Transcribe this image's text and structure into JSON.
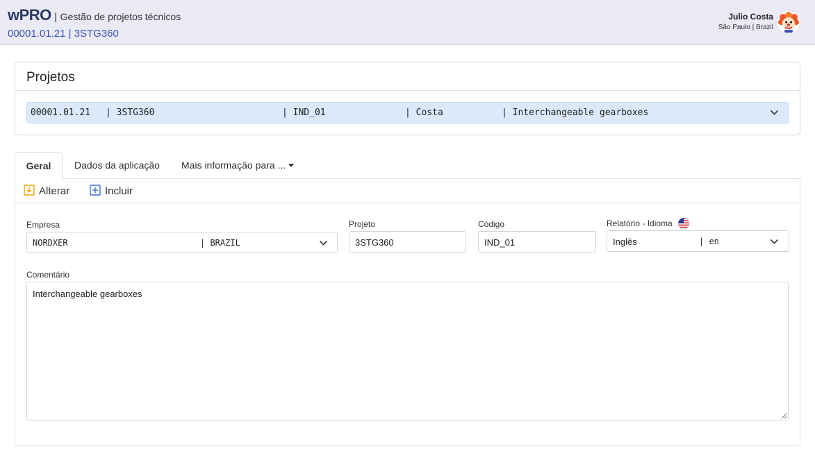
{
  "header": {
    "brand": "wPRO",
    "separator": "|",
    "subtitle": "Gestão de projetos técnicos",
    "project_id": "00001.01.21 | 3STG360",
    "user_name": "Julio Costa",
    "user_location": "São Paulo | Brazil"
  },
  "projetos": {
    "title": "Projetos",
    "selected": {
      "code": "00001.01.21",
      "name": "| 3STG360",
      "ind": "| IND_01",
      "owner": "| Costa",
      "description": "| Interchangeable gearboxes"
    }
  },
  "tabs": [
    {
      "label": "Geral"
    },
    {
      "label": "Dados da aplicação"
    },
    {
      "label": "Mais informação para ..."
    }
  ],
  "toolbar": {
    "alterar": "Alterar",
    "incluir": "Incluir"
  },
  "form": {
    "empresa_label": "Empresa",
    "empresa_name": "NORDXER",
    "empresa_country": "| BRAZIL",
    "projeto_label": "Projeto",
    "projeto_value": "3STG360",
    "codigo_label": "Código",
    "codigo_value": "IND_01",
    "idioma_label": "Relatório - Idioma",
    "idioma_name": "Inglês",
    "idioma_code": "| en",
    "comentario_label": "Comentário",
    "comentario_value": "Interchangeable gearboxes"
  },
  "colors": {
    "topbar": "#e9eaf4",
    "brand": "#2b3a63",
    "accent": "#3f51b5",
    "selected_row": "#dbe9fb",
    "alterar_icon": "#f0a500",
    "incluir_icon": "#3f6fd8"
  },
  "icons": [
    "avatar-clown",
    "chevron-down-icon",
    "arrow-down-box-icon",
    "plus-box-icon",
    "us-flag-icon",
    "resize-grip-icon"
  ]
}
